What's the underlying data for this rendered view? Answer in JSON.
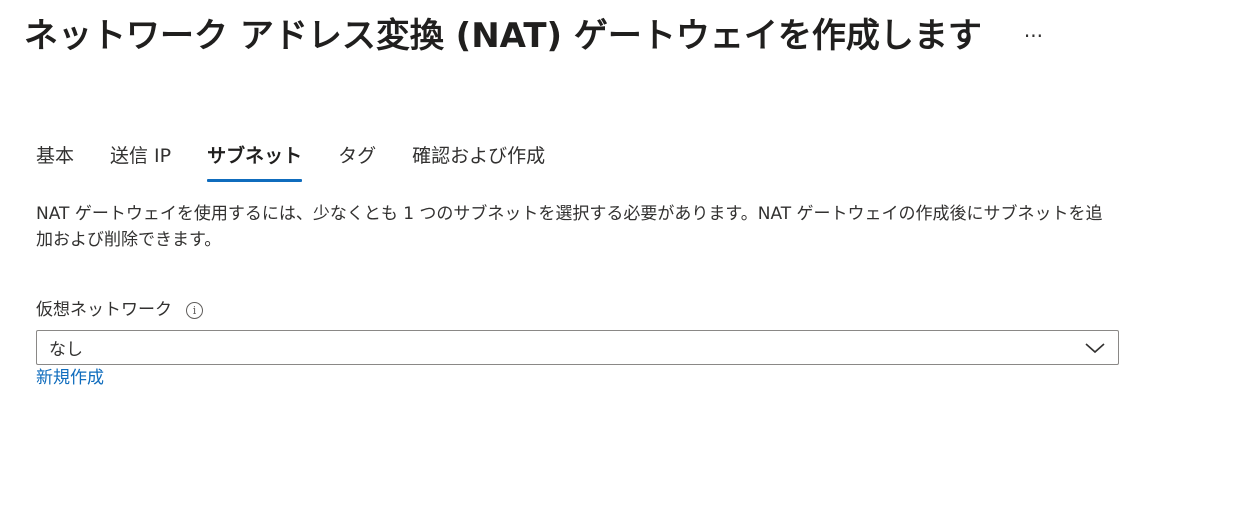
{
  "header": {
    "title": "ネットワーク アドレス変換 (NAT) ゲートウェイを作成します",
    "more_label": "···"
  },
  "tabs": [
    {
      "label": "基本",
      "active": false
    },
    {
      "label": "送信 IP",
      "active": false
    },
    {
      "label": "サブネット",
      "active": true
    },
    {
      "label": "タグ",
      "active": false
    },
    {
      "label": "確認および作成",
      "active": false
    }
  ],
  "main": {
    "description": "NAT ゲートウェイを使用するには、少なくとも 1 つのサブネットを選択する必要があります。NAT ゲートウェイの作成後にサブネットを追加および削除できます。",
    "vnet_label": "仮想ネットワーク",
    "info_glyph": "i",
    "vnet_value": "なし",
    "create_new_label": "新規作成"
  },
  "colors": {
    "accent": "#0f6cbd",
    "text": "#323130",
    "border": "#8a8886"
  },
  "icons": {
    "info": "info-icon",
    "dropdown": "chevron-down-icon",
    "more": "more-icon"
  }
}
